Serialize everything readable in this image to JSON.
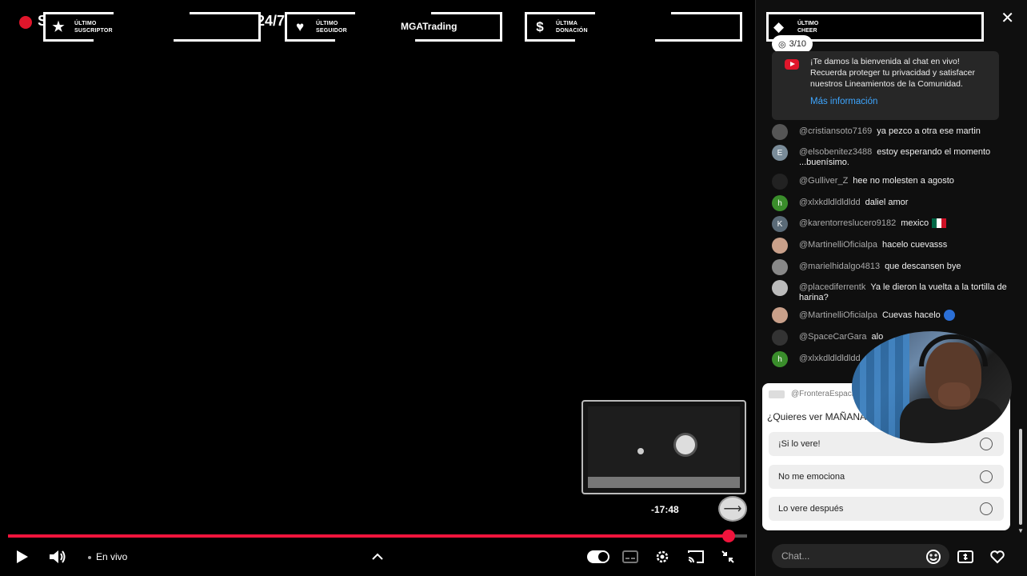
{
  "overlay": {
    "s_letter": "S",
    "stream_label": "24/7",
    "alerts": [
      {
        "label_line1": "ÚLTIMO",
        "label_line2": "SUSCRIPTOR",
        "value": "",
        "icon": "star-icon"
      },
      {
        "label_line1": "ÚLTIMO",
        "label_line2": "SEGUIDOR",
        "value": "MGATrading",
        "icon": "heart-icon"
      },
      {
        "label_line1": "ÚLTIMA",
        "label_line2": "DONACIÓN",
        "value": "",
        "icon": "dollar-icon"
      },
      {
        "label_line1": "ÚLTIMO",
        "label_line2": "CHEER",
        "value": "",
        "icon": "diamond-icon"
      }
    ]
  },
  "player": {
    "time_remaining": "-17:48",
    "live_label": "En vivo",
    "progress": 0.975,
    "accent": "#f0143c"
  },
  "chat": {
    "poll_chip": "3/10",
    "welcome_text": "¡Te damos la bienvenida al chat en vivo! Recuerda proteger tu privacidad y satisfacer nuestros Lineamientos de la Comunidad.",
    "welcome_link": "Más información",
    "messages": [
      {
        "author": "@cristiansoto7169",
        "text": "ya pezco a otra ese martin",
        "avatar": "",
        "avatar_color": "#555555"
      },
      {
        "author": "@elsobenitez3488",
        "text": "estoy esperando el momento ...buenísimo.",
        "avatar": "E",
        "avatar_color": "#7a8c99"
      },
      {
        "author": "@Gulliver_Z",
        "text": "hee no molesten a agosto",
        "avatar": "",
        "avatar_color": "#222222"
      },
      {
        "author": "@xlxkdldldldldd",
        "text": "daliel amor",
        "avatar": "h",
        "avatar_color": "#3a8d2b"
      },
      {
        "author": "@karentorreslucero9182",
        "text": "mexico",
        "avatar": "K",
        "avatar_color": "#5a6a77"
      },
      {
        "author": "@MartinelliOficialpa",
        "text": "hacelo cuevasss",
        "avatar": "",
        "avatar_color": "#c9a08a"
      },
      {
        "author": "@marielhidalgo4813",
        "text": "que descansen bye",
        "avatar": "",
        "avatar_color": "#888888"
      },
      {
        "author": "@placediferrentk",
        "text": "Ya le dieron la vuelta a la tortilla de harina?",
        "avatar": "",
        "avatar_color": "#bbbbbb"
      },
      {
        "author": "@MartinelliOficialpa",
        "text": "Cuevas hacelo",
        "avatar": "",
        "avatar_color": "#c9a08a"
      },
      {
        "author": "@SpaceCarGara",
        "text": "alo",
        "avatar": "",
        "avatar_color": "#333333"
      },
      {
        "author": "@xlxkdldldldldd",
        "text": "",
        "avatar": "h",
        "avatar_color": "#3a8d2b"
      }
    ],
    "poll": {
      "author": "@FronteraEspaci",
      "question": "¿Quieres ver MAÑANA",
      "options": [
        "¡Si lo vere!",
        "No me emociona",
        "Lo vere después"
      ]
    },
    "input_placeholder": "Chat..."
  }
}
